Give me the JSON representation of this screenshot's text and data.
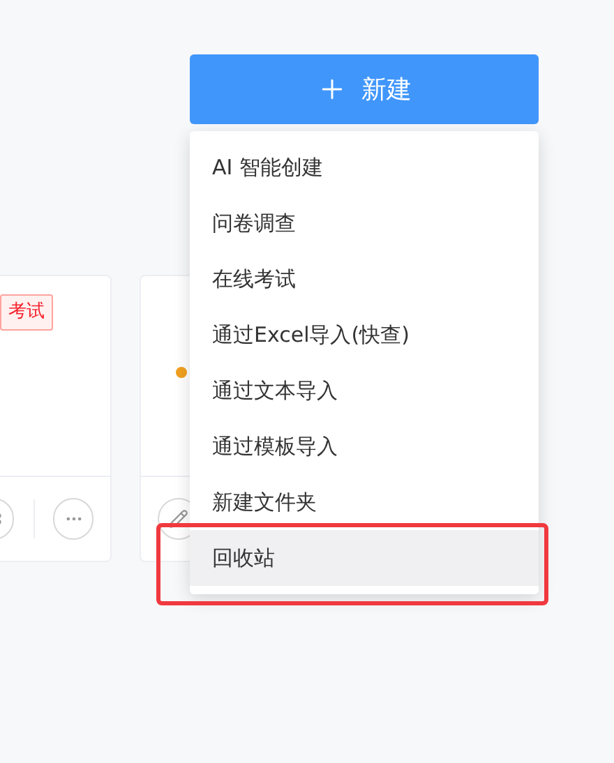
{
  "new_button": {
    "label": "新建"
  },
  "cards": [
    {
      "tag": "考试",
      "kind": "tagged"
    },
    {
      "kind": "status",
      "color": "#f0a020"
    }
  ],
  "menu": {
    "items": [
      {
        "label": "AI 智能创建",
        "selected": false
      },
      {
        "label": "问卷调查",
        "selected": false
      },
      {
        "label": "在线考试",
        "selected": false
      },
      {
        "label": "通过Excel导入(快查)",
        "selected": false
      },
      {
        "label": "通过文本导入",
        "selected": false
      },
      {
        "label": "通过模板导入",
        "selected": false
      },
      {
        "label": "新建文件夹",
        "selected": false
      },
      {
        "label": "回收站",
        "selected": true
      }
    ]
  }
}
